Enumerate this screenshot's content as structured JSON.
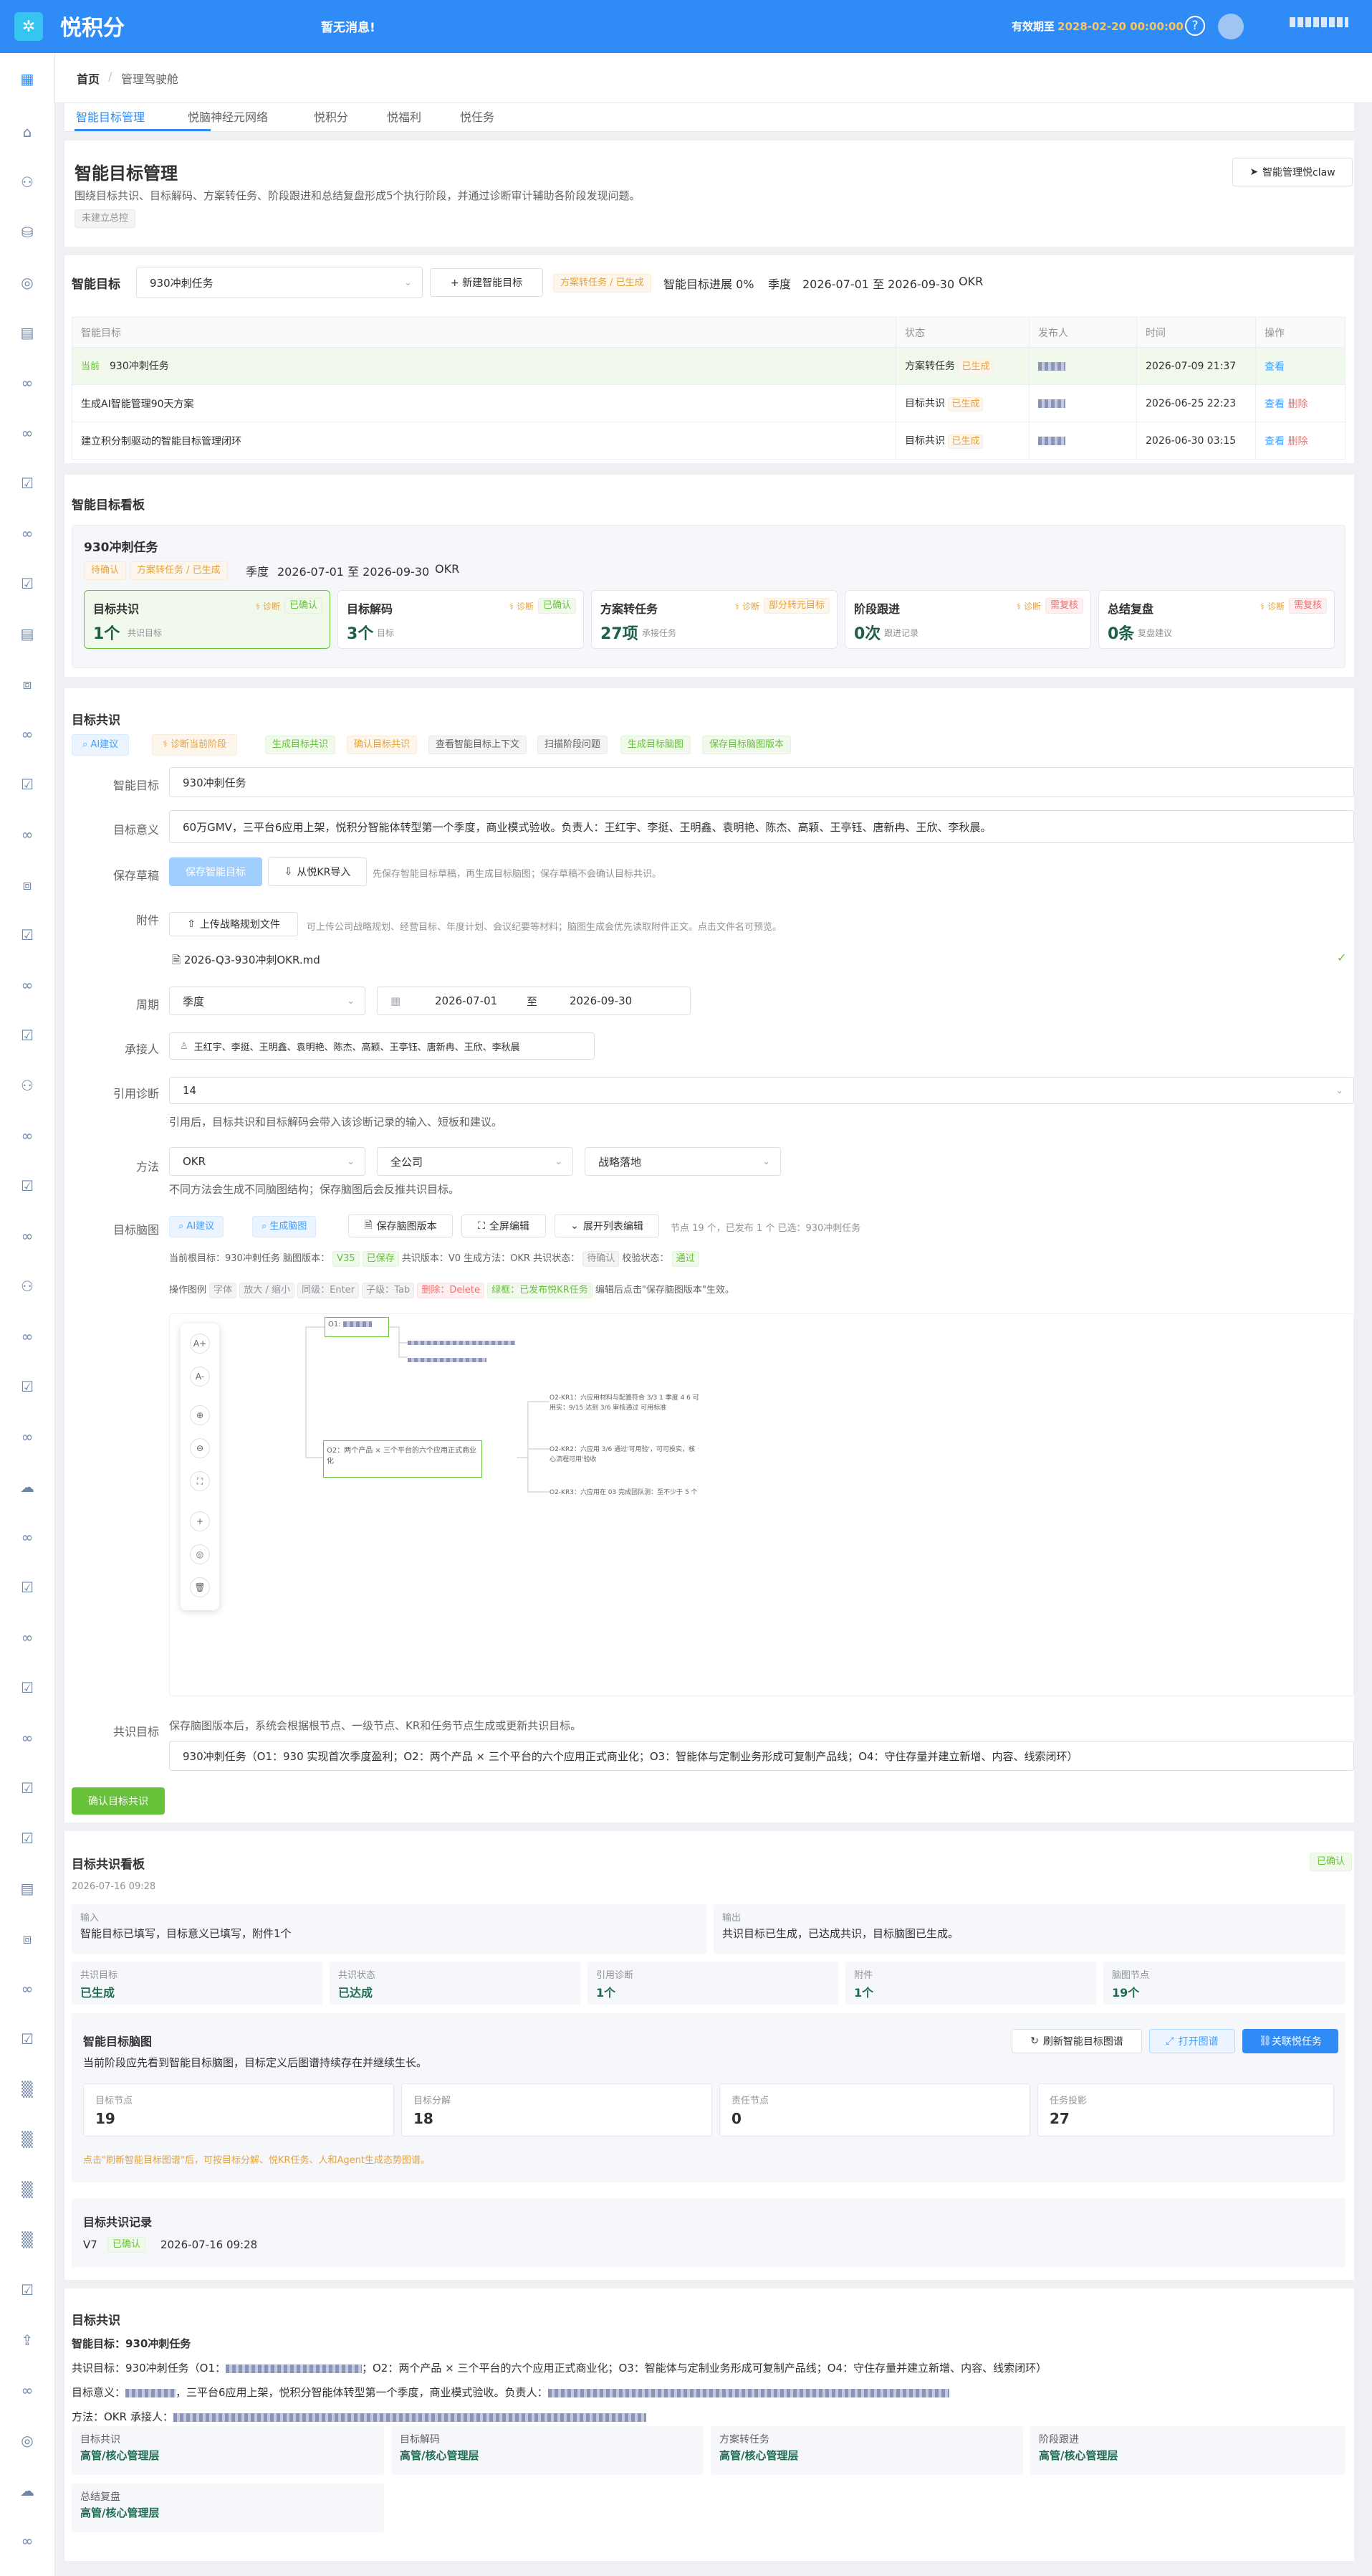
{
  "app": {
    "name": "悦积分",
    "notice": "暂无消息!",
    "expiry_label": "有效期至",
    "expiry_date": "2028-02-20 00:00:00",
    "help": "?"
  },
  "breadcrumb": {
    "home": "首页",
    "sep": "/",
    "current": "管理驾驶舱"
  },
  "tabs": [
    "智能目标管理",
    "悦脑神经元网络",
    "悦积分",
    "悦福利",
    "悦任务"
  ],
  "header": {
    "title": "智能目标管理",
    "desc": "围绕目标共识、目标解码、方案转任务、阶段跟进和总结复盘形成5个执行阶段，并通过诊断审计辅助各阶段发现问题。",
    "badge": "未建立总控",
    "claw_button": "智能管理悦claw"
  },
  "goal_bar": {
    "label": "智能目标",
    "select": "930冲刺任务",
    "new_button": "+ 新建智能目标",
    "status_tag": "方案转任务 / 已生成",
    "progress": "智能目标进展 0%",
    "season": "季度",
    "range": "2026-07-01 至 2026-09-30",
    "method": "OKR"
  },
  "goal_table": {
    "headers": [
      "智能目标",
      "状态",
      "发布人",
      "时间",
      "操作"
    ],
    "rows": [
      {
        "current": "当前",
        "name": "930冲刺任务",
        "status": "方案转任务",
        "status_tag": "已生成",
        "time": "2026-07-09 21:37",
        "ops": [
          "查看"
        ]
      },
      {
        "current": "",
        "name": "生成AI智能管理90天方案",
        "status": "目标共识",
        "status_tag": "已生成",
        "time": "2026-06-25 22:23",
        "ops": [
          "查看",
          "删除"
        ]
      },
      {
        "current": "",
        "name": "建立积分制驱动的智能目标管理闭环",
        "status": "目标共识",
        "status_tag": "已生成",
        "time": "2026-06-30 03:15",
        "ops": [
          "查看",
          "删除"
        ]
      }
    ]
  },
  "board": {
    "title": "智能目标看板",
    "goal_name": "930冲刺任务",
    "tag1": "待确认",
    "tag2": "方案转任务 / 已生成",
    "season": "季度",
    "range": "2026-07-01 至 2026-09-30",
    "method": "OKR",
    "stages": [
      {
        "name": "目标共识",
        "diag": "诊断",
        "tag": "已确认",
        "num": "1个",
        "sub": "共识目标"
      },
      {
        "name": "目标解码",
        "diag": "诊断",
        "tag": "已确认",
        "num": "3个",
        "sub": "目标"
      },
      {
        "name": "方案转任务",
        "diag": "诊断",
        "tag": "部分转元目标",
        "num": "27项",
        "sub": "承接任务"
      },
      {
        "name": "阶段跟进",
        "diag": "诊断",
        "tag": "需复核",
        "num": "0次",
        "sub": "跟进记录"
      },
      {
        "name": "总结复盘",
        "diag": "诊断",
        "tag": "需复核",
        "num": "0条",
        "sub": "复盘建议"
      }
    ]
  },
  "consensus": {
    "title": "目标共识",
    "actions": [
      "AI建议",
      "诊断当前阶段",
      "生成目标共识",
      "确认目标共识",
      "查看智能目标上下文",
      "扫描阶段问题",
      "生成目标脑图",
      "保存目标脑图版本"
    ],
    "goal_label": "智能目标",
    "goal_value": "930冲刺任务",
    "meaning_label": "目标意义",
    "meaning_value": "60万GMV，三平台6应用上架，悦积分智能体转型第一个季度，商业模式验收。负责人：王红宇、李挺、王明鑫、袁明艳、陈杰、高颖、王亭钰、唐新冉、王欣、李秋晨。",
    "draft_label": "保存草稿",
    "draft_btn": "保存智能目标",
    "import_btn": "从悦KR导入",
    "draft_hint": "先保存智能目标草稿，再生成目标脑图；保存草稿不会确认目标共识。",
    "attach_label": "附件",
    "upload_btn": "上传战略规划文件",
    "upload_hint": "可上传公司战略规划、经营目标、年度计划、会议纪要等材料；脑图生成会优先读取附件正文。点击文件名可预览。",
    "file_name": "2026-Q3-930冲刺OKR.md",
    "period_label": "周期",
    "period_value": "季度",
    "date_from": "2026-07-01",
    "date_to_sep": "至",
    "date_to": "2026-09-30",
    "owner_label": "承接人",
    "owner_value": "王红宇、李挺、王明鑫、袁明艳、陈杰、高颖、王亭钰、唐新冉、王欣、李秋晨",
    "cite_label": "引用诊断",
    "cite_value": "14",
    "cite_hint": "引用后，目标共识和目标解码会带入该诊断记录的输入、短板和建议。",
    "method_label": "方法",
    "method_value": "OKR",
    "scope_value": "全公司",
    "strategy_value": "战略落地",
    "method_hint": "不同方法会生成不同脑图结构；保存脑图后会反推共识目标。",
    "mm_label": "目标脑图",
    "mm_buttons": [
      "AI建议",
      "生成脑图",
      "保存脑图版本",
      "全屏编辑",
      "展开列表编辑"
    ],
    "mm_stats": "节点 19 个，已发布 1 个  已选：930冲刺任务",
    "mm_info": {
      "root_label": "当前根目标：930冲刺任务",
      "ver_label": "脑图版本：",
      "ver": "V35",
      "ver_tag": "已保存",
      "share_label": "共识版本：V0",
      "method_label": "生成方法：OKR",
      "cstate_label": "共识状态：",
      "cstate": "待确认",
      "check_label": "校验状态：",
      "check": "通过"
    },
    "mm_legend": {
      "label": "操作图例",
      "items": [
        "字体",
        "放大 / 缩小",
        "同级：Enter",
        "子级：Tab",
        "删除：Delete",
        "绿框：已发布悦KR任务"
      ],
      "hint": "编辑后点击\"保存脑图版本\"生效。"
    },
    "mm_nodes": {
      "o1": "O1:",
      "o2": "O2：两个产品 × 三个平台的六个应用正式商业化",
      "kr1": "O2-KR1：六应用材料与配置符合 3/3 1 季度 4 6 可用实：9/15 达到 3/6 审核通过 可用标准",
      "kr2": "O2-KR2：六应用 3/6 通过'可用验'，可可投实，核心流程可用'验收",
      "kr3": "O2-KR3：六应用在 03 完成团队测：至不少于 5 个"
    },
    "mm_tools": [
      "A+",
      "A-",
      "⊕",
      "⊖",
      "⛶",
      "+",
      "◎",
      "🗑"
    ],
    "share_label": "共识目标",
    "share_hint": "保存脑图版本后，系统会根据根节点、一级节点、KR和任务节点生成或更新共识目标。",
    "share_value": "930冲刺任务（O1：930 实现首次季度盈利；O2：两个产品 × 三个平台的六个应用正式商业化；O3：智能体与定制业务形成可复制产品线；O4：守住存量并建立新增、内容、线索闭环）",
    "confirm_btn": "确认目标共识"
  },
  "cboard": {
    "title": "目标共识看板",
    "time": "2026-07-16 09:28",
    "tag": "已确认",
    "input_label": "输入",
    "input_value": "智能目标已填写，目标意义已填写，附件1个",
    "output_label": "输出",
    "output_value": "共识目标已生成，已达成共识，目标脑图已生成。",
    "stats": [
      {
        "k": "共识目标",
        "v": "已生成"
      },
      {
        "k": "共识状态",
        "v": "已达成"
      },
      {
        "k": "引用诊断",
        "v": "1个"
      },
      {
        "k": "附件",
        "v": "1个"
      },
      {
        "k": "脑图节点",
        "v": "19个"
      }
    ],
    "mm_title": "智能目标脑图",
    "mm_desc": "当前阶段应先看到智能目标脑图，目标定义后图谱持续存在并继续生长。",
    "refresh_btn": "刷新智能目标图谱",
    "open_btn": "打开图谱",
    "link_btn": "关联悦任务",
    "mm_stats": [
      {
        "k": "目标节点",
        "v": "19"
      },
      {
        "k": "目标分解",
        "v": "18"
      },
      {
        "k": "责任节点",
        "v": "0"
      },
      {
        "k": "任务投影",
        "v": "27"
      }
    ],
    "mm_hint": "点击\"刷新智能目标图谱\"后，可按目标分解、悦KR任务、人和Agent生成态势图谱。",
    "record_title": "目标共识记录",
    "record_ver": "V7",
    "record_tag": "已确认",
    "record_time": "2026-07-16 09:28"
  },
  "summary": {
    "title": "目标共识",
    "goal_line": "智能目标：930冲刺任务",
    "share_line": "共识目标：930冲刺任务（O1：",
    "share_tail": "；O2：两个产品 × 三个平台的六个应用正式商业化；O3：智能体与定制业务形成可复制产品线；O4：守住存量并建立新增、内容、线索闭环）",
    "meaning_line": "目标意义：",
    "meaning_mid": "，三平台6应用上架，悦积分智能体转型第一个季度，商业模式验收。负责人：",
    "method_line": "方法：OKR  承接人：",
    "stages": [
      {
        "k": "目标共识",
        "v": "高管/核心管理层"
      },
      {
        "k": "目标解码",
        "v": "高管/核心管理层"
      },
      {
        "k": "方案转任务",
        "v": "高管/核心管理层"
      },
      {
        "k": "阶段跟进",
        "v": "高管/核心管理层"
      },
      {
        "k": "总结复盘",
        "v": "高管/核心管理层"
      }
    ]
  },
  "colors": {
    "primary": "#2f8cf7",
    "success": "#67c23a",
    "warning": "#e6a23c",
    "danger": "#f56c6c"
  }
}
